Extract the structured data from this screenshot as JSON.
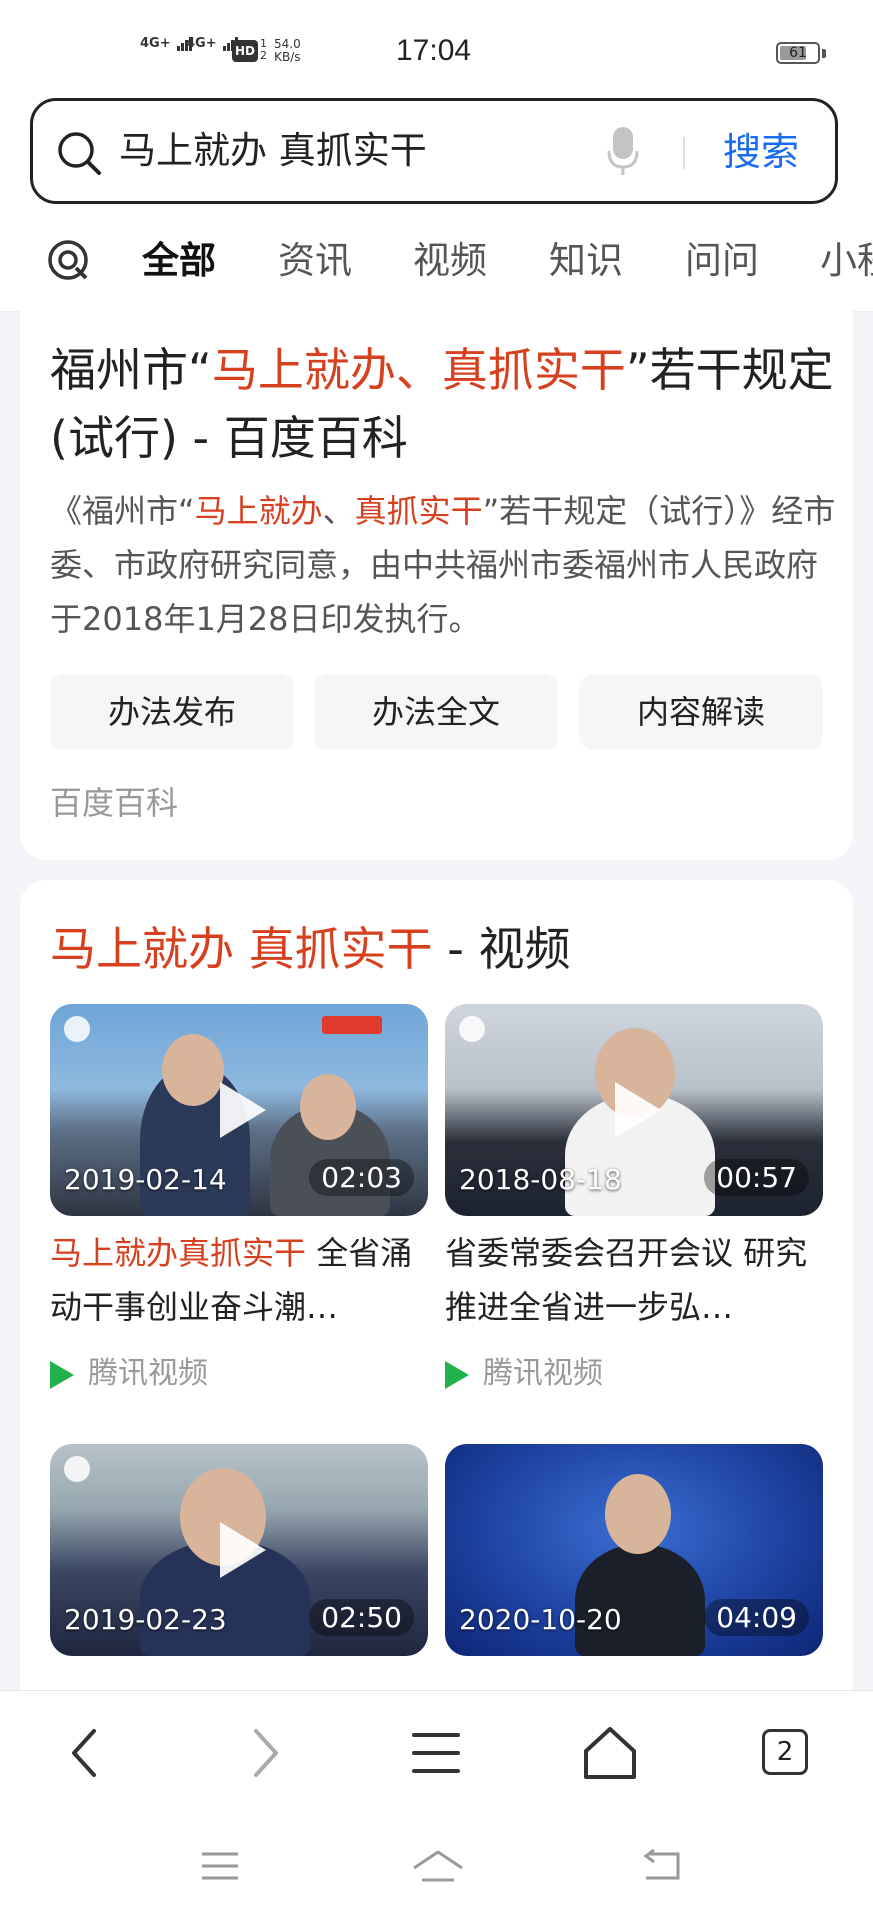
{
  "status_bar": {
    "signal1": "4G+",
    "signal2": "4G+",
    "hd_label": "HD",
    "hd_sub_1": "1",
    "hd_sub_2": "2",
    "net_speed_value": "54.0",
    "net_speed_unit": "KB/s",
    "time": "17:04",
    "battery": "61"
  },
  "search": {
    "query": "马上就办 真抓实干",
    "button_label": "搜索"
  },
  "tabs": [
    {
      "label": "全部",
      "active": true
    },
    {
      "label": "资讯"
    },
    {
      "label": "视频"
    },
    {
      "label": "知识"
    },
    {
      "label": "问问"
    },
    {
      "label": "小程"
    }
  ],
  "result1": {
    "title_prefix": "福州市“",
    "title_hl1": "马上就办",
    "title_sep": "、",
    "title_hl2": "真抓实干",
    "title_suffix": "”若干规定(试行) - 百度百科",
    "desc_prefix": "《福州市“",
    "desc_hl1": "马上就办",
    "desc_sep": "、",
    "desc_hl2": "真抓实干",
    "desc_suffix": "”若干规定（试行）》经市委、市政府研究同意，由中共福州市委福州市人民政府于2018年1月28日印发执行。",
    "chips": [
      "办法发布",
      "办法全文",
      "内容解读"
    ],
    "source": "百度百科"
  },
  "videos_section": {
    "heading_hl": "马上就办 真抓实干",
    "heading_suffix": " - 视频",
    "videos": [
      {
        "date": "2019-02-14",
        "duration": "02:03",
        "title_hl": "马上就办真抓实干",
        "title_rest": " 全省涌动干事创业奋斗潮…",
        "source": "腾讯视频"
      },
      {
        "date": "2018-08-18",
        "duration": "00:57",
        "title_hl": "",
        "title_rest": "省委常委会召开会议 研究推进全省进一步弘…",
        "source": "腾讯视频"
      },
      {
        "date": "2019-02-23",
        "duration": "02:50"
      },
      {
        "date": "2020-10-20",
        "duration": "04:09"
      }
    ]
  },
  "bottom_nav": {
    "tab_count": "2"
  }
}
